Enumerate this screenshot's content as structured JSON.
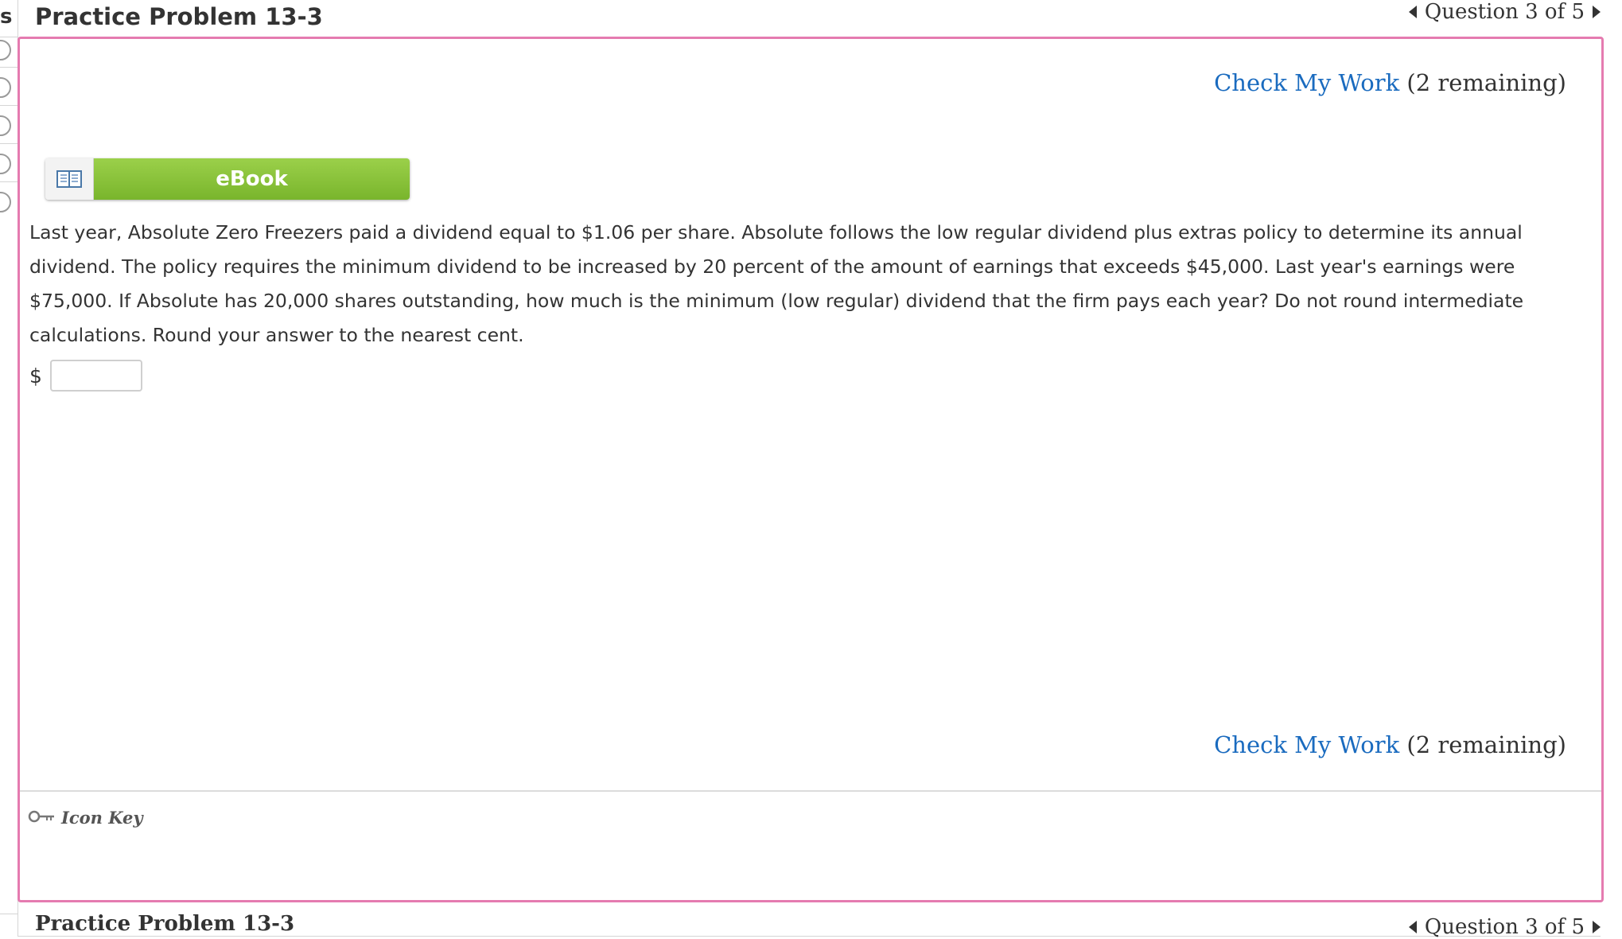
{
  "header": {
    "title": "Practice Problem 13-3",
    "question_nav": "Question 3 of 5"
  },
  "left_strip": {
    "partial_char": "s"
  },
  "check_my_work": {
    "link_label": "Check My Work",
    "remaining": "(2 remaining)"
  },
  "ebook": {
    "label": "eBook",
    "icon": "book-icon"
  },
  "question": {
    "text": "Last year, Absolute Zero Freezers paid a dividend equal to $1.06 per share. Absolute follows the low regular dividend plus extras policy to determine its annual dividend. The policy requires the minimum dividend to be increased by 20 percent of the amount of earnings that exceeds $45,000. Last year's earnings were $75,000. If Absolute has 20,000 shares outstanding, how much is the minimum (low regular) dividend that the firm pays each year? Do not round intermediate calculations. Round your answer to the nearest cent."
  },
  "answer": {
    "prefix": "$",
    "value": "",
    "placeholder": ""
  },
  "icon_key": {
    "label": "Icon Key",
    "icon": "key-icon"
  },
  "footer": {
    "title": "Practice Problem 13-3",
    "question_nav": "Question 3 of 5"
  },
  "colors": {
    "panel_border": "#e57bb0",
    "link": "#1a6bbf",
    "ebook_green": "#8cc540"
  }
}
